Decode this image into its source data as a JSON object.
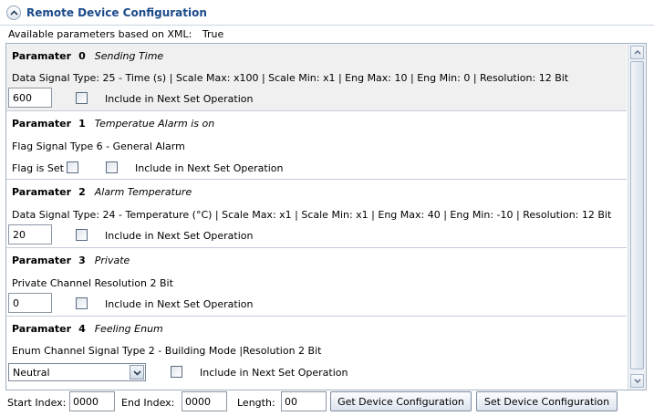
{
  "header": {
    "title": "Remote Device Configuration",
    "collapse_icon": "chevron-up-icon"
  },
  "available": {
    "label": "Available parameters based on XML:",
    "value": "True"
  },
  "params": [
    {
      "title": "Paramater",
      "number": "0",
      "name": "Sending Time",
      "line1": "Data Signal Type:   25 - Time (s)   | Scale Max:   x100   | Scale Min:   x1   | Eng Max:   10   | Eng Min:   0   | Resolution:   12 Bit",
      "input_value": "600",
      "include_label": "Include in Next Set Operation"
    },
    {
      "title": "Paramater",
      "number": "1",
      "name": "Temperatue Alarm is on",
      "line1": "Flag Signal Type   6 - General Alarm",
      "flag_label": "Flag is Set",
      "include_label": "Include in Next Set Operation"
    },
    {
      "title": "Paramater",
      "number": "2",
      "name": "Alarm Temperature",
      "line1": "Data Signal Type:   24 - Temperature (°C)   | Scale Max:   x1   | Scale Min:   x1   | Eng Max:   40   | Eng Min:   -10   | Resolution:   12 Bit",
      "input_value": "20",
      "include_label": "Include in Next Set Operation"
    },
    {
      "title": "Paramater",
      "number": "3",
      "name": "Private",
      "line1": "Private Channel   Resolution   2 Bit",
      "input_value": "0",
      "include_label": "Include in Next Set Operation"
    },
    {
      "title": "Paramater",
      "number": "4",
      "name": "Feeling Enum",
      "line1": "Enum Channel   Signal Type   2 - Building Mode   |Resolution   2 Bit",
      "select_value": "Neutral",
      "include_label": "Include in Next Set Operation"
    }
  ],
  "footer": {
    "start_label": "Start Index:",
    "start_value": "0000",
    "end_label": "End Index:",
    "end_value": "0000",
    "length_label": "Length:",
    "length_value": "00",
    "get_button": "Get Device Configuration",
    "set_button": "Set Device Configuration"
  }
}
